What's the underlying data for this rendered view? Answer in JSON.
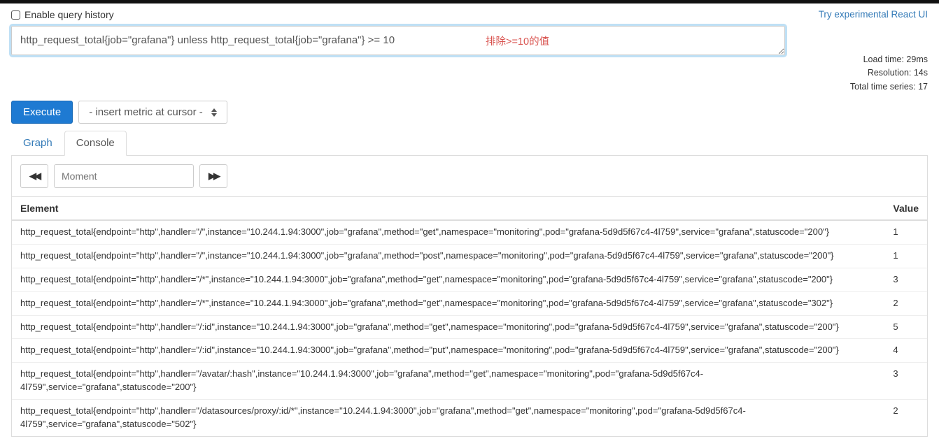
{
  "header": {
    "enable_history_label": "Enable query history",
    "react_link": "Try experimental React UI"
  },
  "query": {
    "expression": "http_request_total{job=\"grafana\"} unless http_request_total{job=\"grafana\"} >= 10",
    "annotation": "排除>=10的值"
  },
  "stats": {
    "load_time": "Load time: 29ms",
    "resolution": "Resolution: 14s",
    "total_series": "Total time series: 17"
  },
  "controls": {
    "execute_label": "Execute",
    "metric_placeholder": "- insert metric at cursor -"
  },
  "tabs": {
    "graph": "Graph",
    "console": "Console"
  },
  "time_nav": {
    "moment_placeholder": "Moment"
  },
  "table": {
    "col_element": "Element",
    "col_value": "Value",
    "rows": [
      {
        "element": "http_request_total{endpoint=\"http\",handler=\"/\",instance=\"10.244.1.94:3000\",job=\"grafana\",method=\"get\",namespace=\"monitoring\",pod=\"grafana-5d9d5f67c4-4l759\",service=\"grafana\",statuscode=\"200\"}",
        "value": "1"
      },
      {
        "element": "http_request_total{endpoint=\"http\",handler=\"/\",instance=\"10.244.1.94:3000\",job=\"grafana\",method=\"post\",namespace=\"monitoring\",pod=\"grafana-5d9d5f67c4-4l759\",service=\"grafana\",statuscode=\"200\"}",
        "value": "1"
      },
      {
        "element": "http_request_total{endpoint=\"http\",handler=\"/*\",instance=\"10.244.1.94:3000\",job=\"grafana\",method=\"get\",namespace=\"monitoring\",pod=\"grafana-5d9d5f67c4-4l759\",service=\"grafana\",statuscode=\"200\"}",
        "value": "3"
      },
      {
        "element": "http_request_total{endpoint=\"http\",handler=\"/*\",instance=\"10.244.1.94:3000\",job=\"grafana\",method=\"get\",namespace=\"monitoring\",pod=\"grafana-5d9d5f67c4-4l759\",service=\"grafana\",statuscode=\"302\"}",
        "value": "2"
      },
      {
        "element": "http_request_total{endpoint=\"http\",handler=\"/:id\",instance=\"10.244.1.94:3000\",job=\"grafana\",method=\"get\",namespace=\"monitoring\",pod=\"grafana-5d9d5f67c4-4l759\",service=\"grafana\",statuscode=\"200\"}",
        "value": "5"
      },
      {
        "element": "http_request_total{endpoint=\"http\",handler=\"/:id\",instance=\"10.244.1.94:3000\",job=\"grafana\",method=\"put\",namespace=\"monitoring\",pod=\"grafana-5d9d5f67c4-4l759\",service=\"grafana\",statuscode=\"200\"}",
        "value": "4"
      },
      {
        "element": "http_request_total{endpoint=\"http\",handler=\"/avatar/:hash\",instance=\"10.244.1.94:3000\",job=\"grafana\",method=\"get\",namespace=\"monitoring\",pod=\"grafana-5d9d5f67c4-4l759\",service=\"grafana\",statuscode=\"200\"}",
        "value": "3"
      },
      {
        "element": "http_request_total{endpoint=\"http\",handler=\"/datasources/proxy/:id/*\",instance=\"10.244.1.94:3000\",job=\"grafana\",method=\"get\",namespace=\"monitoring\",pod=\"grafana-5d9d5f67c4-4l759\",service=\"grafana\",statuscode=\"502\"}",
        "value": "2"
      }
    ]
  }
}
